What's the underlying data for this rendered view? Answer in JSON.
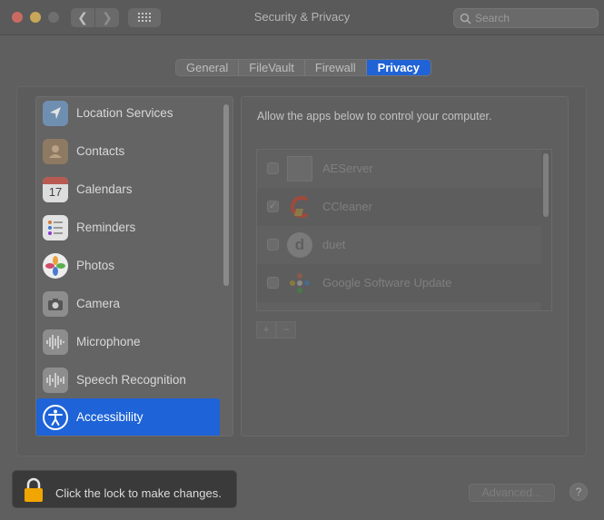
{
  "window": {
    "title": "Security & Privacy",
    "search_placeholder": "Search"
  },
  "tabs": [
    {
      "label": "General"
    },
    {
      "label": "FileVault"
    },
    {
      "label": "Firewall"
    },
    {
      "label": "Privacy"
    }
  ],
  "active_tab": "Privacy",
  "sidebar": {
    "items": [
      {
        "label": "Location Services",
        "icon": "location-arrow-icon"
      },
      {
        "label": "Contacts",
        "icon": "contacts-icon"
      },
      {
        "label": "Calendars",
        "icon": "calendar-icon",
        "icon_text": "17"
      },
      {
        "label": "Reminders",
        "icon": "reminders-icon"
      },
      {
        "label": "Photos",
        "icon": "photos-icon"
      },
      {
        "label": "Camera",
        "icon": "camera-icon"
      },
      {
        "label": "Microphone",
        "icon": "microphone-waveform-icon"
      },
      {
        "label": "Speech Recognition",
        "icon": "speech-waveform-icon"
      },
      {
        "label": "Accessibility",
        "icon": "accessibility-icon"
      }
    ],
    "selected": "Accessibility"
  },
  "main": {
    "description": "Allow the apps below to control your computer.",
    "apps": [
      {
        "name": "AEServer",
        "checked": false,
        "icon": "generic-app-icon"
      },
      {
        "name": "CCleaner",
        "checked": true,
        "icon": "ccleaner-icon"
      },
      {
        "name": "duet",
        "checked": false,
        "icon": "duet-icon",
        "icon_text": "d"
      },
      {
        "name": "Google Software Update",
        "checked": false,
        "icon": "google-update-icon"
      }
    ],
    "add_label": "+",
    "remove_label": "−"
  },
  "footer": {
    "lock_text": "Click the lock to make changes.",
    "advanced_label": "Advanced...",
    "help_label": "?"
  },
  "colors": {
    "accent": "#1e63d7",
    "window_bg": "#5f5f5f",
    "lock_bar_bg": "#3a3a3a",
    "lock_icon": "#f0a500"
  }
}
